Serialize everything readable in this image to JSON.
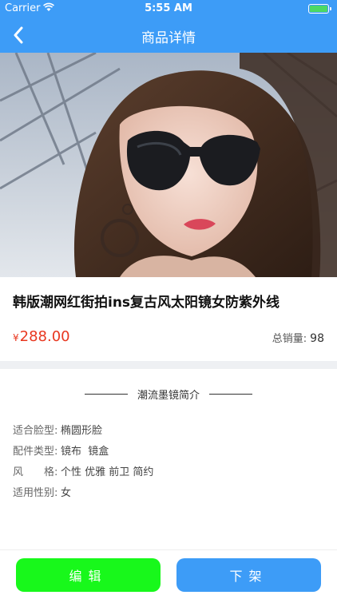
{
  "status_bar": {
    "carrier": "Carrier",
    "time": "5:55 AM"
  },
  "nav": {
    "title": "商品详情",
    "back_icon": "chevron-left-icon"
  },
  "product": {
    "title": "韩版潮网红街拍ins复古风太阳镜女防紫外线",
    "currency": "¥",
    "price": "288.00",
    "sales_label": "总销量:",
    "sales_count": "98"
  },
  "intro": {
    "heading": "潮流墨镜简介",
    "attributes": [
      {
        "key": "适合脸型:",
        "value": "椭圆形脸"
      },
      {
        "key": "配件类型:",
        "value": "镜布  镜盒"
      },
      {
        "key": "风　　格:",
        "value": "个性 优雅 前卫 简约"
      },
      {
        "key": "适用性别:",
        "value": "女"
      }
    ]
  },
  "actions": {
    "edit_label": "编辑",
    "delist_label": "下架"
  },
  "colors": {
    "nav_bg": "#3d9cf7",
    "price": "#e8371f",
    "edit_btn": "#18f81b",
    "delist_btn": "#3d9cf7"
  }
}
